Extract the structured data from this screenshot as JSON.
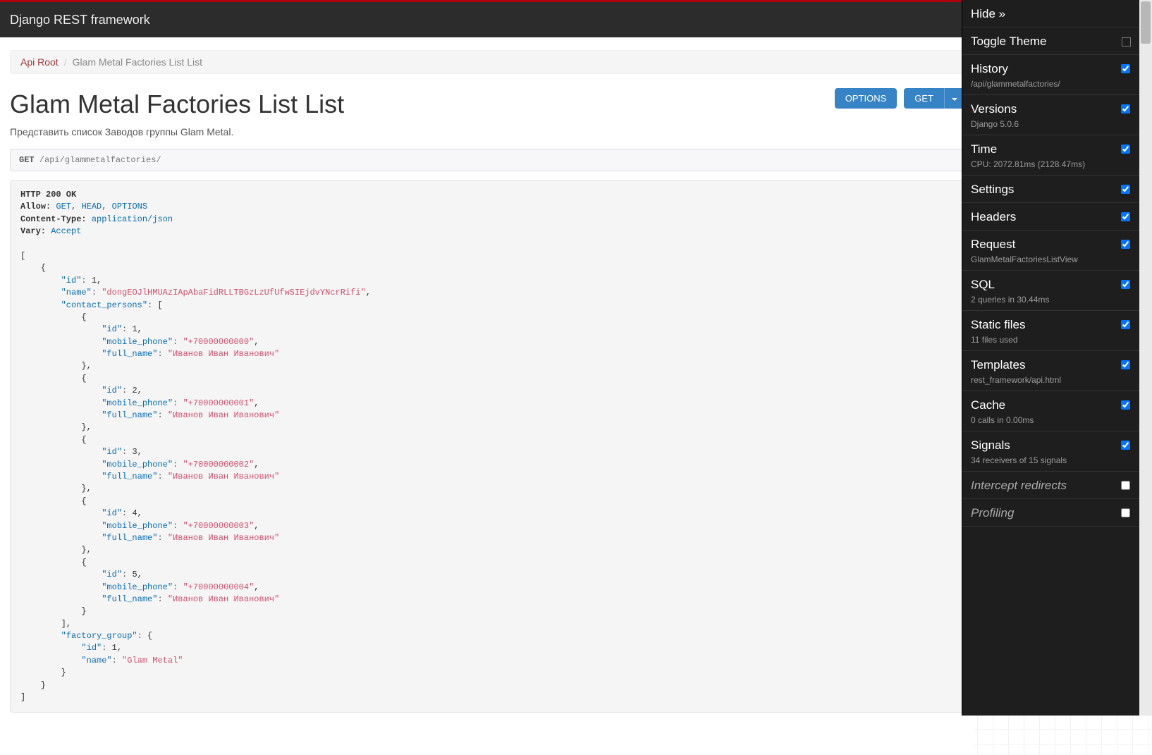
{
  "navbar": {
    "brand": "Django REST framework"
  },
  "breadcrumb": {
    "root": "Api Root",
    "current": "Glam Metal Factories List List"
  },
  "page": {
    "title": "Glam Metal Factories List List",
    "description": "Представить список Заводов группы Glam Metal."
  },
  "buttons": {
    "options": "OPTIONS",
    "get": "GET"
  },
  "request": {
    "method": "GET",
    "path": "/api/glammetalfactories/"
  },
  "response": {
    "status_line": "HTTP 200 OK",
    "headers": {
      "allow_label": "Allow:",
      "allow": [
        "GET",
        "HEAD",
        "OPTIONS"
      ],
      "content_type_label": "Content-Type:",
      "content_type": "application/json",
      "vary_label": "Vary:",
      "vary": "Accept"
    },
    "body": [
      {
        "id": 1,
        "name": "dongEOJlHMUAzIApAbaFidRLLTBGzLzUfUfwSIEjdvYNcrRifi",
        "contact_persons": [
          {
            "id": 1,
            "mobile_phone": "+70000000000",
            "full_name": "Иванов Иван Иванович"
          },
          {
            "id": 2,
            "mobile_phone": "+70000000001",
            "full_name": "Иванов Иван Иванович"
          },
          {
            "id": 3,
            "mobile_phone": "+70000000002",
            "full_name": "Иванов Иван Иванович"
          },
          {
            "id": 4,
            "mobile_phone": "+70000000003",
            "full_name": "Иванов Иван Иванович"
          },
          {
            "id": 5,
            "mobile_phone": "+70000000004",
            "full_name": "Иванов Иван Иванович"
          }
        ],
        "factory_group": {
          "id": 1,
          "name": "Glam Metal"
        }
      }
    ]
  },
  "debug_toolbar": {
    "hide": "Hide »",
    "toggle_theme": "Toggle Theme",
    "panels": [
      {
        "title": "History",
        "sub": "/api/glammetalfactories/",
        "checked": true
      },
      {
        "title": "Versions",
        "sub": "Django 5.0.6",
        "checked": true
      },
      {
        "title": "Time",
        "sub": "CPU: 2072.81ms (2128.47ms)",
        "checked": true
      },
      {
        "title": "Settings",
        "sub": "",
        "checked": true
      },
      {
        "title": "Headers",
        "sub": "",
        "checked": true
      },
      {
        "title": "Request",
        "sub": "GlamMetalFactoriesListView",
        "checked": true
      },
      {
        "title": "SQL",
        "sub": "2 queries in 30.44ms",
        "checked": true
      },
      {
        "title": "Static files",
        "sub": "11 files used",
        "checked": true
      },
      {
        "title": "Templates",
        "sub": "rest_framework/api.html",
        "checked": true
      },
      {
        "title": "Cache",
        "sub": "0 calls in 0.00ms",
        "checked": true
      },
      {
        "title": "Signals",
        "sub": "34 receivers of 15 signals",
        "checked": true
      },
      {
        "title": "Intercept redirects",
        "sub": "",
        "checked": false,
        "disabled": true
      },
      {
        "title": "Profiling",
        "sub": "",
        "checked": false,
        "disabled": true
      }
    ]
  }
}
